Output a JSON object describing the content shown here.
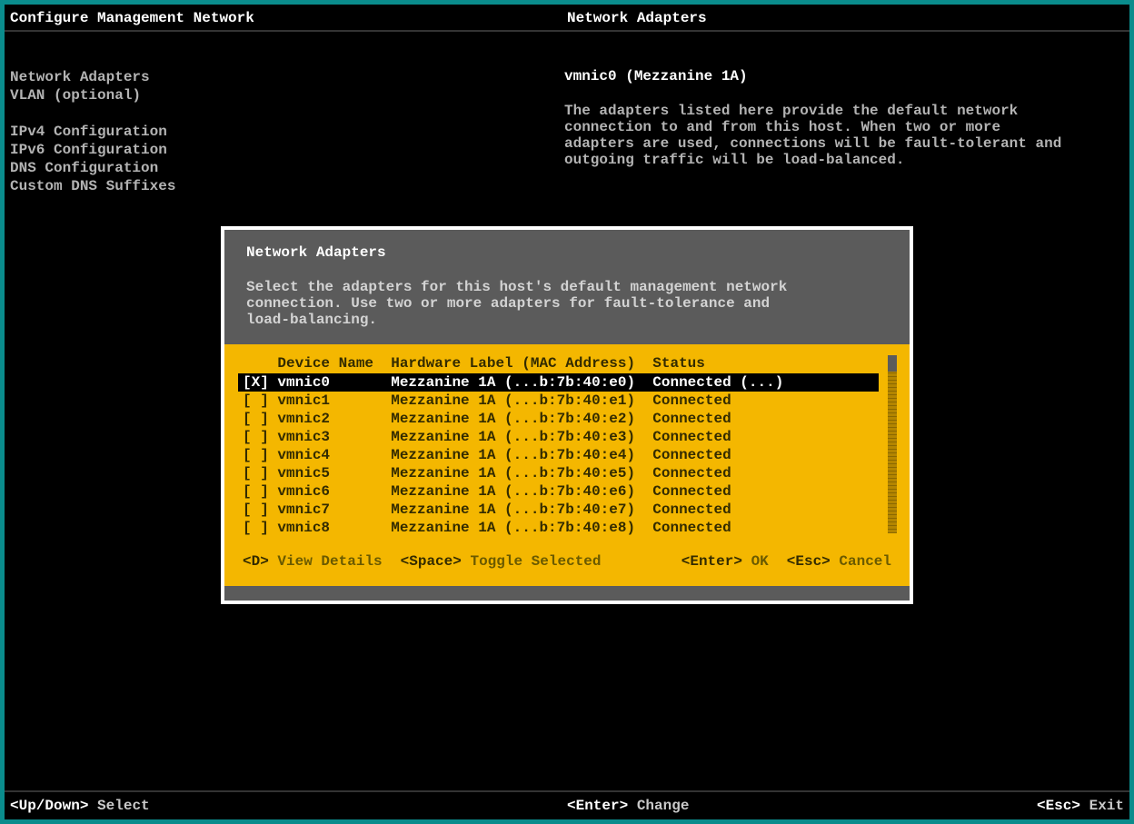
{
  "topbar": {
    "left": "Configure Management Network",
    "right": "Network Adapters"
  },
  "sidebar": {
    "items": [
      "Network Adapters",
      "VLAN (optional)",
      "",
      "IPv4 Configuration",
      "IPv6 Configuration",
      "DNS Configuration",
      "Custom DNS Suffixes"
    ]
  },
  "desc": {
    "subject": "vmnic0 (Mezzanine 1A)",
    "text": "The adapters listed here provide the default network connection to and from this host. When two or more adapters are used, connections will be fault-tolerant and outgoing traffic will be load-balanced."
  },
  "dialog": {
    "title": "Network Adapters",
    "subtitle": "Select the adapters for this host's default management network connection. Use two or more adapters for fault-tolerance and load-balancing.",
    "columns": {
      "c1": "Device Name",
      "c2": "Hardware Label (MAC Address)",
      "c3": "Status"
    },
    "rows": [
      {
        "sel": true,
        "checked": true,
        "name": "vmnic0",
        "hw": "Mezzanine 1A (...b:7b:40:e0)",
        "status": "Connected (...)"
      },
      {
        "sel": false,
        "checked": false,
        "name": "vmnic1",
        "hw": "Mezzanine 1A (...b:7b:40:e1)",
        "status": "Connected"
      },
      {
        "sel": false,
        "checked": false,
        "name": "vmnic2",
        "hw": "Mezzanine 1A (...b:7b:40:e2)",
        "status": "Connected"
      },
      {
        "sel": false,
        "checked": false,
        "name": "vmnic3",
        "hw": "Mezzanine 1A (...b:7b:40:e3)",
        "status": "Connected"
      },
      {
        "sel": false,
        "checked": false,
        "name": "vmnic4",
        "hw": "Mezzanine 1A (...b:7b:40:e4)",
        "status": "Connected"
      },
      {
        "sel": false,
        "checked": false,
        "name": "vmnic5",
        "hw": "Mezzanine 1A (...b:7b:40:e5)",
        "status": "Connected"
      },
      {
        "sel": false,
        "checked": false,
        "name": "vmnic6",
        "hw": "Mezzanine 1A (...b:7b:40:e6)",
        "status": "Connected"
      },
      {
        "sel": false,
        "checked": false,
        "name": "vmnic7",
        "hw": "Mezzanine 1A (...b:7b:40:e7)",
        "status": "Connected"
      },
      {
        "sel": false,
        "checked": false,
        "name": "vmnic8",
        "hw": "Mezzanine 1A (...b:7b:40:e8)",
        "status": "Connected"
      }
    ],
    "footer": {
      "k1": "<D>",
      "a1": "View Details",
      "k2": "<Space>",
      "a2": "Toggle Selected",
      "k3": "<Enter>",
      "a3": "OK",
      "k4": "<Esc>",
      "a4": "Cancel"
    }
  },
  "footer": {
    "k1": "<Up/Down>",
    "a1": "Select",
    "k2": "<Enter>",
    "a2": "Change",
    "k3": "<Esc>",
    "a3": "Exit"
  }
}
